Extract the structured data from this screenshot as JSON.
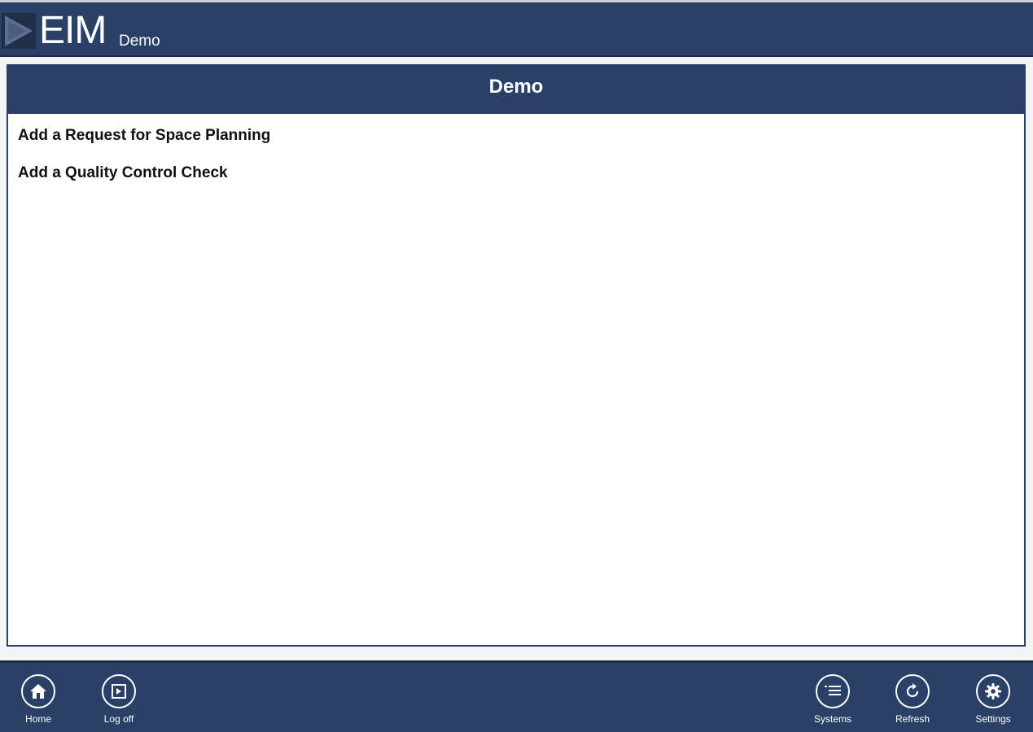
{
  "header": {
    "logo_icon": "play-triangle-logo",
    "title": "EIM",
    "subtitle": "Demo"
  },
  "panel": {
    "title": "Demo",
    "items": [
      {
        "label": "Add a Request for Space Planning"
      },
      {
        "label": "Add a Quality Control Check"
      }
    ]
  },
  "appbar": {
    "left": [
      {
        "label": "Home",
        "icon": "home-icon"
      },
      {
        "label": "Log off",
        "icon": "log-off-icon"
      }
    ],
    "right": [
      {
        "label": "Systems",
        "icon": "list-icon"
      },
      {
        "label": "Refresh",
        "icon": "refresh-icon"
      },
      {
        "label": "Settings",
        "icon": "gear-icon"
      }
    ]
  },
  "colors": {
    "brand": "#2a4066",
    "background": "#f3f4f6",
    "panel": "#ffffff"
  }
}
